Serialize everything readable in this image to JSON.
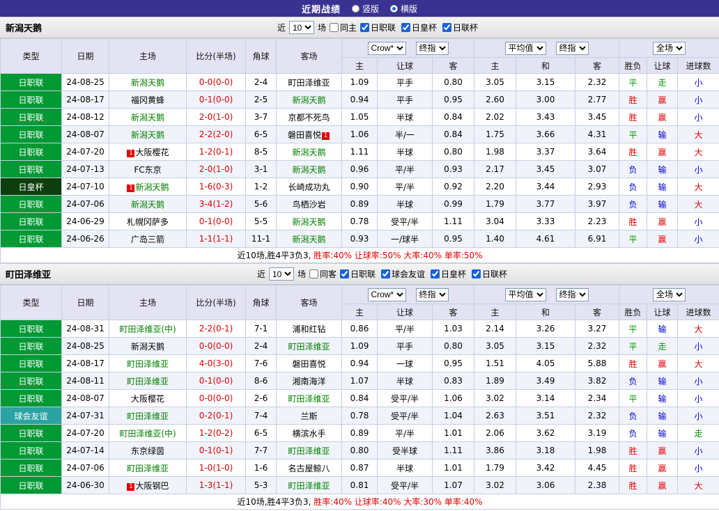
{
  "topbar": {
    "title": "近期战绩",
    "layout_options": [
      {
        "label": "竖版",
        "selected": false
      },
      {
        "label": "横版",
        "selected": true
      }
    ]
  },
  "filters_common": {
    "near": "近",
    "games": "场"
  },
  "table_header": {
    "col_type": "类型",
    "col_date": "日期",
    "col_home": "主场",
    "col_score": "比分(半场)",
    "col_corner": "角球",
    "col_away": "客场",
    "sel_crow": "Crow*",
    "sel_final": "终指",
    "sel_avg": "平均值",
    "sel_full": "全场",
    "sub_home": "主",
    "sub_handicap": "让球",
    "sub_away": "客",
    "sub_h": "主",
    "sub_d": "和",
    "sub_a": "客",
    "sub_result": "胜负",
    "sub_hresult": "让球",
    "sub_goals": "进球数"
  },
  "sections": [
    {
      "team": "新潟天鹅",
      "filters": {
        "near_value": "10",
        "same_label": "同主",
        "leagues": [
          {
            "label": "日职联"
          },
          {
            "label": "日皇杯"
          },
          {
            "label": "日联杯"
          }
        ]
      },
      "summary_prefix": "近10场,胜4平3负3,",
      "summary_stats": "胜率:40% 让球率:50% 大率:40% 单率:50%",
      "rows": [
        {
          "league": "日职联",
          "league_class": "lg-j",
          "date": "24-08-25",
          "home_pre": "",
          "home": "新潟天鹅",
          "home_class": "t-focus",
          "home_post": "",
          "score": "0-0(0-0)",
          "corner": "2-4",
          "away_pre": "",
          "away": "町田泽维亚",
          "away_class": "",
          "away_post": "",
          "a_home": "1.09",
          "handicap": "平手",
          "a_away": "0.80",
          "e_home": "3.05",
          "e_draw": "3.15",
          "e_away": "2.32",
          "r_match": "平",
          "r_match_c": "c-green",
          "r_handicap": "走",
          "r_handicap_c": "c-green",
          "r_goals": "小",
          "r_goals_c": "c-blue"
        },
        {
          "league": "日职联",
          "league_class": "lg-j",
          "date": "24-08-17",
          "home_pre": "",
          "home": "福冈黄蜂",
          "home_class": "",
          "home_post": "",
          "score": "0-1(0-0)",
          "corner": "2-5",
          "away_pre": "",
          "away": "新潟天鹅",
          "away_class": "t-focus",
          "away_post": "",
          "a_home": "0.94",
          "handicap": "平手",
          "a_away": "0.95",
          "e_home": "2.60",
          "e_draw": "3.00",
          "e_away": "2.77",
          "r_match": "胜",
          "r_match_c": "c-red",
          "r_handicap": "赢",
          "r_handicap_c": "c-red",
          "r_goals": "小",
          "r_goals_c": "c-blue"
        },
        {
          "league": "日职联",
          "league_class": "lg-j",
          "date": "24-08-12",
          "home_pre": "",
          "home": "新潟天鹅",
          "home_class": "t-focus",
          "home_post": "",
          "score": "2-0(1-0)",
          "corner": "3-7",
          "away_pre": "",
          "away": "京都不死鸟",
          "away_class": "",
          "away_post": "",
          "a_home": "1.05",
          "handicap": "半球",
          "a_away": "0.84",
          "e_home": "2.02",
          "e_draw": "3.43",
          "e_away": "3.45",
          "r_match": "胜",
          "r_match_c": "c-red",
          "r_handicap": "赢",
          "r_handicap_c": "c-red",
          "r_goals": "小",
          "r_goals_c": "c-blue"
        },
        {
          "league": "日职联",
          "league_class": "lg-j",
          "date": "24-08-07",
          "home_pre": "",
          "home": "新潟天鹅",
          "home_class": "t-focus",
          "home_post": "",
          "score": "2-2(2-0)",
          "corner": "6-5",
          "away_pre": "",
          "away": "磐田喜悦",
          "away_class": "",
          "away_post": "1",
          "a_home": "1.06",
          "handicap": "半/一",
          "a_away": "0.84",
          "e_home": "1.75",
          "e_draw": "3.66",
          "e_away": "4.31",
          "r_match": "平",
          "r_match_c": "c-green",
          "r_handicap": "输",
          "r_handicap_c": "c-blue",
          "r_goals": "大",
          "r_goals_c": "c-red"
        },
        {
          "league": "日职联",
          "league_class": "lg-j",
          "date": "24-07-20",
          "home_pre": "1",
          "home": "大阪樱花",
          "home_class": "",
          "home_post": "",
          "score": "1-2(0-1)",
          "corner": "8-5",
          "away_pre": "",
          "away": "新潟天鹅",
          "away_class": "t-focus",
          "away_post": "",
          "a_home": "1.11",
          "handicap": "半球",
          "a_away": "0.80",
          "e_home": "1.98",
          "e_draw": "3.37",
          "e_away": "3.64",
          "r_match": "胜",
          "r_match_c": "c-red",
          "r_handicap": "赢",
          "r_handicap_c": "c-red",
          "r_goals": "大",
          "r_goals_c": "c-red"
        },
        {
          "league": "日职联",
          "league_class": "lg-j",
          "date": "24-07-13",
          "home_pre": "",
          "home": "FC东京",
          "home_class": "",
          "home_post": "",
          "score": "2-0(1-0)",
          "corner": "3-1",
          "away_pre": "",
          "away": "新潟天鹅",
          "away_class": "t-focus",
          "away_post": "",
          "a_home": "0.96",
          "handicap": "平/半",
          "a_away": "0.93",
          "e_home": "2.17",
          "e_draw": "3.45",
          "e_away": "3.07",
          "r_match": "负",
          "r_match_c": "c-blue",
          "r_handicap": "输",
          "r_handicap_c": "c-blue",
          "r_goals": "小",
          "r_goals_c": "c-blue"
        },
        {
          "league": "日皇杯",
          "league_class": "lg-royal",
          "date": "24-07-10",
          "home_pre": "1",
          "home": "新潟天鹅",
          "home_class": "t-focus",
          "home_post": "",
          "score": "1-6(0-3)",
          "corner": "1-2",
          "away_pre": "",
          "away": "长崎成功丸",
          "away_class": "",
          "away_post": "",
          "a_home": "0.90",
          "handicap": "平/半",
          "a_away": "0.92",
          "e_home": "2.20",
          "e_draw": "3.44",
          "e_away": "2.93",
          "r_match": "负",
          "r_match_c": "c-blue",
          "r_handicap": "输",
          "r_handicap_c": "c-blue",
          "r_goals": "大",
          "r_goals_c": "c-red"
        },
        {
          "league": "日职联",
          "league_class": "lg-j",
          "date": "24-07-06",
          "home_pre": "",
          "home": "新潟天鹅",
          "home_class": "t-focus",
          "home_post": "",
          "score": "3-4(1-2)",
          "corner": "5-6",
          "away_pre": "",
          "away": "鸟栖沙岩",
          "away_class": "",
          "away_post": "",
          "a_home": "0.89",
          "handicap": "半球",
          "a_away": "0.99",
          "e_home": "1.79",
          "e_draw": "3.77",
          "e_away": "3.97",
          "r_match": "负",
          "r_match_c": "c-blue",
          "r_handicap": "输",
          "r_handicap_c": "c-blue",
          "r_goals": "大",
          "r_goals_c": "c-red"
        },
        {
          "league": "日职联",
          "league_class": "lg-j",
          "date": "24-06-29",
          "home_pre": "",
          "home": "札幌冈萨多",
          "home_class": "",
          "home_post": "",
          "score": "0-1(0-0)",
          "corner": "5-5",
          "away_pre": "",
          "away": "新潟天鹅",
          "away_class": "t-focus",
          "away_post": "",
          "a_home": "0.78",
          "handicap": "受平/半",
          "a_away": "1.11",
          "e_home": "3.04",
          "e_draw": "3.33",
          "e_away": "2.23",
          "r_match": "胜",
          "r_match_c": "c-red",
          "r_handicap": "赢",
          "r_handicap_c": "c-red",
          "r_goals": "小",
          "r_goals_c": "c-blue"
        },
        {
          "league": "日职联",
          "league_class": "lg-j",
          "date": "24-06-26",
          "home_pre": "",
          "home": "广岛三箭",
          "home_class": "",
          "home_post": "",
          "score": "1-1(1-1)",
          "corner": "11-1",
          "away_pre": "",
          "away": "新潟天鹅",
          "away_class": "t-focus",
          "away_post": "",
          "a_home": "0.93",
          "handicap": "一/球半",
          "a_away": "0.95",
          "e_home": "1.40",
          "e_draw": "4.61",
          "e_away": "6.91",
          "r_match": "平",
          "r_match_c": "c-green",
          "r_handicap": "赢",
          "r_handicap_c": "c-red",
          "r_goals": "小",
          "r_goals_c": "c-blue"
        }
      ]
    },
    {
      "team": "町田泽维亚",
      "filters": {
        "near_value": "10",
        "same_label": "同客",
        "leagues": [
          {
            "label": "日职联"
          },
          {
            "label": "球会友谊"
          },
          {
            "label": "日皇杯"
          },
          {
            "label": "日联杯"
          }
        ]
      },
      "summary_prefix": "近10场,胜4平3负3,",
      "summary_stats": "胜率:40% 让球率:40% 大率:30% 单率:40%",
      "rows": [
        {
          "league": "日职联",
          "league_class": "lg-j",
          "date": "24-08-31",
          "home_pre": "",
          "home": "町田泽维亚(中)",
          "home_class": "t-focus",
          "home_post": "",
          "score": "2-2(0-1)",
          "corner": "7-1",
          "away_pre": "",
          "away": "浦和红钻",
          "away_class": "",
          "away_post": "",
          "a_home": "0.86",
          "handicap": "平/半",
          "a_away": "1.03",
          "e_home": "2.14",
          "e_draw": "3.26",
          "e_away": "3.27",
          "r_match": "平",
          "r_match_c": "c-green",
          "r_handicap": "输",
          "r_handicap_c": "c-blue",
          "r_goals": "大",
          "r_goals_c": "c-red"
        },
        {
          "league": "日职联",
          "league_class": "lg-j",
          "date": "24-08-25",
          "home_pre": "",
          "home": "新潟天鹅",
          "home_class": "",
          "home_post": "",
          "score": "0-0(0-0)",
          "corner": "2-4",
          "away_pre": "",
          "away": "町田泽维亚",
          "away_class": "t-focus",
          "away_post": "",
          "a_home": "1.09",
          "handicap": "平手",
          "a_away": "0.80",
          "e_home": "3.05",
          "e_draw": "3.15",
          "e_away": "2.32",
          "r_match": "平",
          "r_match_c": "c-green",
          "r_handicap": "走",
          "r_handicap_c": "c-green",
          "r_goals": "小",
          "r_goals_c": "c-blue"
        },
        {
          "league": "日职联",
          "league_class": "lg-j",
          "date": "24-08-17",
          "home_pre": "",
          "home": "町田泽维亚",
          "home_class": "t-focus",
          "home_post": "",
          "score": "4-0(3-0)",
          "corner": "7-6",
          "away_pre": "",
          "away": "磐田喜悦",
          "away_class": "",
          "away_post": "",
          "a_home": "0.94",
          "handicap": "一球",
          "a_away": "0.95",
          "e_home": "1.51",
          "e_draw": "4.05",
          "e_away": "5.88",
          "r_match": "胜",
          "r_match_c": "c-red",
          "r_handicap": "赢",
          "r_handicap_c": "c-red",
          "r_goals": "大",
          "r_goals_c": "c-red"
        },
        {
          "league": "日职联",
          "league_class": "lg-j",
          "date": "24-08-11",
          "home_pre": "",
          "home": "町田泽维亚",
          "home_class": "t-focus",
          "home_post": "",
          "score": "0-1(0-0)",
          "corner": "8-6",
          "away_pre": "",
          "away": "湘南海洋",
          "away_class": "",
          "away_post": "",
          "a_home": "1.07",
          "handicap": "半球",
          "a_away": "0.83",
          "e_home": "1.89",
          "e_draw": "3.49",
          "e_away": "3.82",
          "r_match": "负",
          "r_match_c": "c-blue",
          "r_handicap": "输",
          "r_handicap_c": "c-blue",
          "r_goals": "小",
          "r_goals_c": "c-blue"
        },
        {
          "league": "日职联",
          "league_class": "lg-j",
          "date": "24-08-07",
          "home_pre": "",
          "home": "大阪樱花",
          "home_class": "",
          "home_post": "",
          "score": "0-0(0-0)",
          "corner": "2-6",
          "away_pre": "",
          "away": "町田泽维亚",
          "away_class": "t-focus",
          "away_post": "",
          "a_home": "0.84",
          "handicap": "受平/半",
          "a_away": "1.06",
          "e_home": "3.02",
          "e_draw": "3.14",
          "e_away": "2.34",
          "r_match": "平",
          "r_match_c": "c-green",
          "r_handicap": "输",
          "r_handicap_c": "c-blue",
          "r_goals": "小",
          "r_goals_c": "c-blue"
        },
        {
          "league": "球会友谊",
          "league_class": "lg-friendly",
          "date": "24-07-31",
          "home_pre": "",
          "home": "町田泽维亚",
          "home_class": "t-focus",
          "home_post": "",
          "score": "0-2(0-1)",
          "corner": "7-4",
          "away_pre": "",
          "away": "兰斯",
          "away_class": "",
          "away_post": "",
          "a_home": "0.78",
          "handicap": "受平/半",
          "a_away": "1.04",
          "e_home": "2.63",
          "e_draw": "3.51",
          "e_away": "2.32",
          "r_match": "负",
          "r_match_c": "c-blue",
          "r_handicap": "输",
          "r_handicap_c": "c-blue",
          "r_goals": "小",
          "r_goals_c": "c-blue"
        },
        {
          "league": "日职联",
          "league_class": "lg-j",
          "date": "24-07-20",
          "home_pre": "",
          "home": "町田泽维亚(中)",
          "home_class": "t-focus",
          "home_post": "",
          "score": "1-2(0-2)",
          "corner": "6-5",
          "away_pre": "",
          "away": "横滨水手",
          "away_class": "",
          "away_post": "",
          "a_home": "0.89",
          "handicap": "平/半",
          "a_away": "1.01",
          "e_home": "2.06",
          "e_draw": "3.62",
          "e_away": "3.19",
          "r_match": "负",
          "r_match_c": "c-blue",
          "r_handicap": "输",
          "r_handicap_c": "c-blue",
          "r_goals": "走",
          "r_goals_c": "c-green"
        },
        {
          "league": "日职联",
          "league_class": "lg-j",
          "date": "24-07-14",
          "home_pre": "",
          "home": "东京绿茵",
          "home_class": "",
          "home_post": "",
          "score": "0-1(0-1)",
          "corner": "7-7",
          "away_pre": "",
          "away": "町田泽维亚",
          "away_class": "t-focus",
          "away_post": "",
          "a_home": "0.80",
          "handicap": "受半球",
          "a_away": "1.11",
          "e_home": "3.86",
          "e_draw": "3.18",
          "e_away": "1.98",
          "r_match": "胜",
          "r_match_c": "c-red",
          "r_handicap": "赢",
          "r_handicap_c": "c-red",
          "r_goals": "小",
          "r_goals_c": "c-blue"
        },
        {
          "league": "日职联",
          "league_class": "lg-j",
          "date": "24-07-06",
          "home_pre": "",
          "home": "町田泽维亚",
          "home_class": "t-focus",
          "home_post": "",
          "score": "1-0(1-0)",
          "corner": "1-6",
          "away_pre": "",
          "away": "名古屋鲸八",
          "away_class": "",
          "away_post": "",
          "a_home": "0.87",
          "handicap": "半球",
          "a_away": "1.01",
          "e_home": "1.79",
          "e_draw": "3.42",
          "e_away": "4.45",
          "r_match": "胜",
          "r_match_c": "c-red",
          "r_handicap": "赢",
          "r_handicap_c": "c-red",
          "r_goals": "小",
          "r_goals_c": "c-blue"
        },
        {
          "league": "日职联",
          "league_class": "lg-j",
          "date": "24-06-30",
          "home_pre": "1",
          "home": "大阪钢巴",
          "home_class": "",
          "home_post": "",
          "score": "1-3(1-1)",
          "corner": "5-3",
          "away_pre": "",
          "away": "町田泽维亚",
          "away_class": "t-focus",
          "away_post": "",
          "a_home": "0.81",
          "handicap": "受平/半",
          "a_away": "1.07",
          "e_home": "3.02",
          "e_draw": "3.06",
          "e_away": "2.38",
          "r_match": "胜",
          "r_match_c": "c-red",
          "r_handicap": "赢",
          "r_handicap_c": "c-red",
          "r_goals": "大",
          "r_goals_c": "c-red"
        }
      ]
    }
  ]
}
